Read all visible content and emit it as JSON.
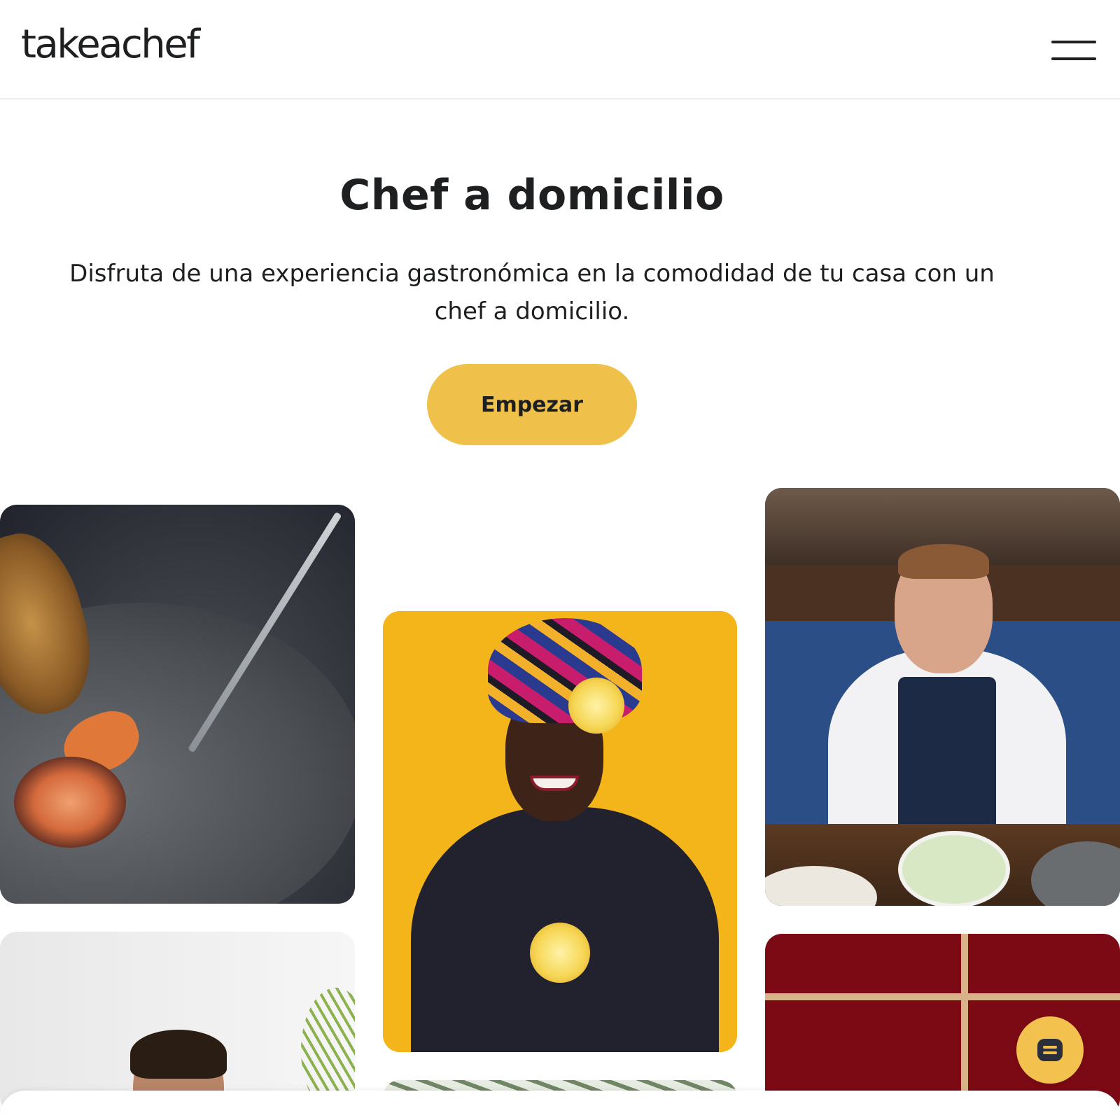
{
  "header": {
    "logo_text": "takeachef",
    "menu_icon": "hamburger-menu-icon"
  },
  "hero": {
    "title": "Chef a domicilio",
    "subtitle": "Disfruta de una experiencia gastronómica en la comodidad de tu casa con un chef a domicilio.",
    "cta_label": "Empezar"
  },
  "colors": {
    "accent": "#efc04a",
    "text": "#1d1f20",
    "chat_button": "#f2c14e"
  },
  "chat": {
    "icon": "chat-icon"
  }
}
